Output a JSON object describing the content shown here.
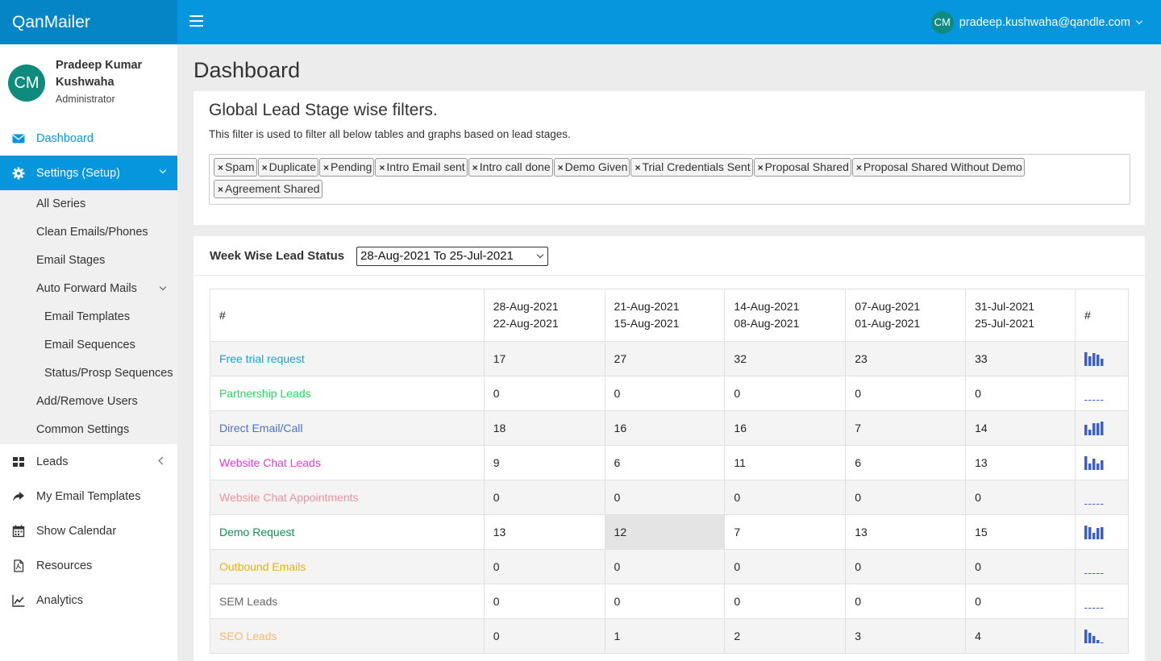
{
  "app": {
    "brand": "QanMailer"
  },
  "header": {
    "user_initials": "CM",
    "user_email": "pradeep.kushwaha@qandle.com"
  },
  "profile": {
    "initials": "CM",
    "name": "Pradeep Kumar Kushwaha",
    "role": "Administrator"
  },
  "sidebar": {
    "dashboard": "Dashboard",
    "settings": "Settings (Setup)",
    "settings_sub": {
      "all_series": "All Series",
      "clean": "Clean Emails/Phones",
      "email_stages": "Email Stages",
      "auto_forward": "Auto Forward Mails",
      "email_templates": "Email Templates",
      "email_sequences": "Email Sequences",
      "status_seq": "Status/Prosp Sequences",
      "add_remove_users": "Add/Remove Users",
      "common_settings": "Common Settings"
    },
    "leads": "Leads",
    "my_email_templates": "My Email Templates",
    "show_calendar": "Show Calendar",
    "resources": "Resources",
    "analytics": "Analytics"
  },
  "page": {
    "title": "Dashboard"
  },
  "filters": {
    "title": "Global Lead Stage wise filters.",
    "description": "This filter is used to filter all below tables and graphs based on lead stages.",
    "remove_symbol": "×",
    "tags": [
      "Spam",
      "Duplicate",
      "Pending",
      "Intro Email sent",
      "Intro call done",
      "Demo Given",
      "Trial Credentials Sent",
      "Proposal Shared",
      "Proposal Shared Without Demo",
      "Agreement Shared"
    ]
  },
  "week_status": {
    "title": "Week Wise Lead Status",
    "range": "28-Aug-2021 To 25-Jul-2021",
    "head_first": "#",
    "head_last": "#",
    "weeks": [
      {
        "start": "28-Aug-2021",
        "end": "22-Aug-2021"
      },
      {
        "start": "21-Aug-2021",
        "end": "15-Aug-2021"
      },
      {
        "start": "14-Aug-2021",
        "end": "08-Aug-2021"
      },
      {
        "start": "07-Aug-2021",
        "end": "01-Aug-2021"
      },
      {
        "start": "31-Jul-2021",
        "end": "25-Jul-2021"
      }
    ],
    "rows": [
      {
        "name": "Free trial request",
        "color": "#17a2d6",
        "values": [
          17,
          27,
          32,
          23,
          33
        ]
      },
      {
        "name": "Partnership Leads",
        "color": "#26d95d",
        "values": [
          0,
          0,
          0,
          0,
          0
        ]
      },
      {
        "name": "Direct Email/Call",
        "color": "#4a6fd6",
        "values": [
          18,
          16,
          16,
          7,
          14
        ]
      },
      {
        "name": "Website Chat Leads",
        "color": "#e83adf",
        "values": [
          9,
          6,
          11,
          6,
          13
        ]
      },
      {
        "name": "Website Chat Appointments",
        "color": "#f3919a",
        "values": [
          0,
          0,
          0,
          0,
          0
        ]
      },
      {
        "name": "Demo Request",
        "color": "#0a9652",
        "values": [
          13,
          12,
          7,
          13,
          15
        ]
      },
      {
        "name": "Outbound Emails",
        "color": "#e0b50c",
        "values": [
          0,
          0,
          0,
          0,
          0
        ]
      },
      {
        "name": "SEM Leads",
        "color": "#666666",
        "values": [
          0,
          0,
          0,
          0,
          0
        ]
      },
      {
        "name": "SEO Leads",
        "color": "#f6b870",
        "values": [
          0,
          1,
          2,
          3,
          4
        ]
      }
    ],
    "spark_color": "#3b5fc8"
  }
}
